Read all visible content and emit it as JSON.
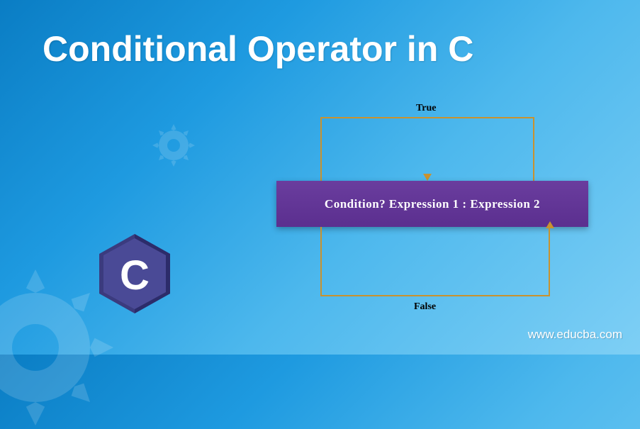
{
  "title": "Conditional Operator in C",
  "diagram": {
    "label_true": "True",
    "label_false": "False",
    "expression": "Condition? Expression 1 : Expression 2"
  },
  "watermark": "www.educba.com",
  "chart_data": {
    "type": "diagram",
    "title": "Conditional Operator in C",
    "nodes": [
      {
        "id": "syntax",
        "text": "Condition? Expression 1 : Expression 2"
      }
    ],
    "edges": [
      {
        "from": "Condition",
        "to": "Expression 1",
        "label": "True"
      },
      {
        "from": "Condition",
        "to": "Expression 2",
        "label": "False"
      }
    ],
    "annotations": [
      "True branch arrow points to Expression 1",
      "False branch arrow points to Expression 2"
    ]
  }
}
